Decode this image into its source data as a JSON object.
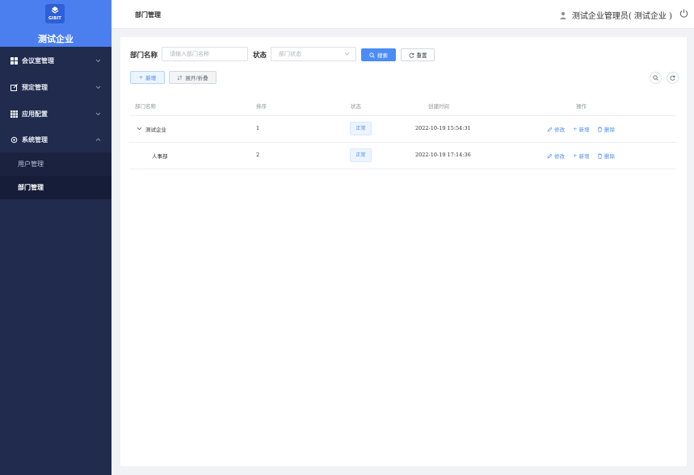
{
  "brand": {
    "logo_text": "GIBIT",
    "name": "测试企业"
  },
  "sidebar": {
    "items": [
      {
        "label": "会议室管理",
        "icon": "grid-icon"
      },
      {
        "label": "预定管理",
        "icon": "edit-icon"
      },
      {
        "label": "应用配置",
        "icon": "apps-icon"
      },
      {
        "label": "系统管理",
        "icon": "gear-icon"
      }
    ],
    "sub_items": [
      {
        "label": "用户管理",
        "active": false
      },
      {
        "label": "部门管理",
        "active": true
      }
    ]
  },
  "header": {
    "breadcrumb": "部门管理",
    "user": "测试企业管理员( 测试企业 )"
  },
  "search": {
    "dept_name_label": "部门名称",
    "dept_name_placeholder": "请输入部门名称",
    "status_label": "状态",
    "status_placeholder": "部门状态",
    "search_button": "搜索",
    "reset_button": "重置"
  },
  "toolbar": {
    "add_button": "新增",
    "expand_button": "展开/折叠"
  },
  "table": {
    "headers": [
      "部门名称",
      "排序",
      "状态",
      "创建时间",
      "操作"
    ],
    "rows": [
      {
        "name": "测试企业",
        "order": "1",
        "status": "正常",
        "created": "2022-10-19 15:54:31",
        "has_children": true
      },
      {
        "name": "人事部",
        "order": "2",
        "status": "正常",
        "created": "2022-10-19 17:14:36",
        "has_children": false
      }
    ],
    "actions": {
      "edit": "修改",
      "add": "新增",
      "delete": "删除"
    }
  },
  "colors": {
    "sidebar": "#202b4e",
    "brand": "#4b7ff0",
    "primary": "#4b8cf5"
  }
}
